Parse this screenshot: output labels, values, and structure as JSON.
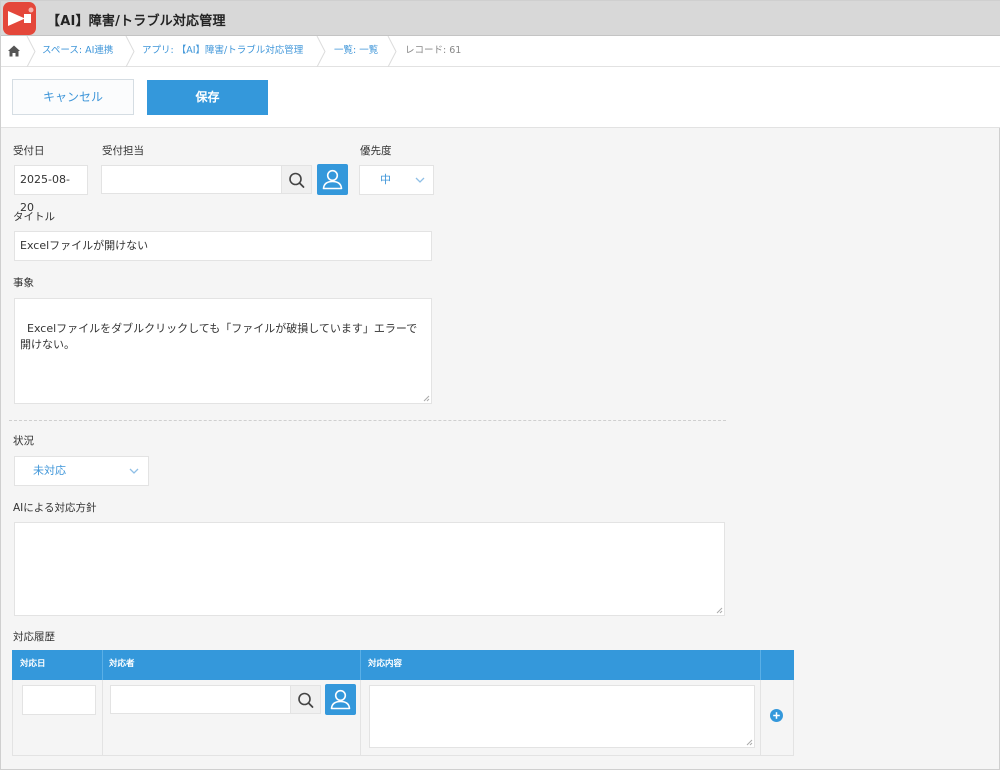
{
  "app": {
    "title": "【AI】障害/トラブル対応管理",
    "icon": "app-logo-icon"
  },
  "breadcrumb": {
    "home_icon": "home-icon",
    "items": [
      {
        "label": "スペース: AI連携"
      },
      {
        "label": "アプリ: 【AI】障害/トラブル対応管理"
      },
      {
        "label": "一覧: 一覧"
      },
      {
        "label": "レコード: 61"
      }
    ]
  },
  "actions": {
    "cancel_label": "キャンセル",
    "save_label": "保存"
  },
  "form": {
    "received_date": {
      "label": "受付日",
      "value": "2025-08-20"
    },
    "assignee": {
      "label": "受付担当",
      "value": ""
    },
    "priority": {
      "label": "優先度",
      "value": "中"
    },
    "title": {
      "label": "タイトル",
      "value": "Excelファイルが開けない"
    },
    "incident": {
      "label": "事象",
      "value": "Excelファイルをダブルクリックしても「ファイルが破損しています」エラーで開けない。"
    },
    "status": {
      "label": "状況",
      "value": "未対応"
    },
    "ai_policy": {
      "label": "AIによる対応方針",
      "value": ""
    },
    "history": {
      "label": "対応履歴",
      "columns": [
        "対応日",
        "対応者",
        "対応内容"
      ],
      "rows": [
        {
          "date": "",
          "person": "",
          "content": ""
        }
      ]
    }
  },
  "colors": {
    "accent": "#3498db",
    "link": "#3f96d9",
    "logo": "#e4473a"
  }
}
